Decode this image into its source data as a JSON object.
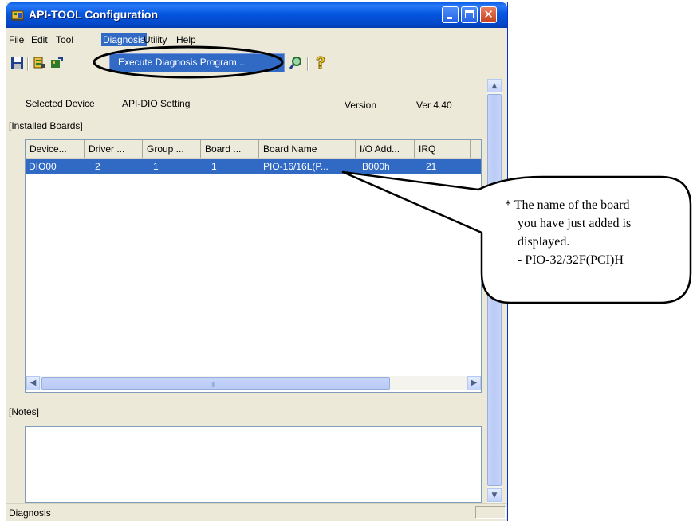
{
  "window": {
    "title": "API-TOOL Configuration"
  },
  "menubar": {
    "items": [
      "File",
      "Edit",
      "Tool",
      "Diagnosis",
      "Utility",
      "Help"
    ],
    "active": "Diagnosis"
  },
  "dropdown": {
    "item": "Execute Diagnosis Program..."
  },
  "toolbar": {
    "icons": [
      "save-icon",
      "settings-icon",
      "import-icon",
      "magnifier-icon",
      "help-question-icon"
    ]
  },
  "device_info": {
    "selected_device_label": "Selected Device",
    "selected_device_value": "API-DIO Setting",
    "version_label": "Version",
    "version_value": "Ver 4.40"
  },
  "installed_boards": {
    "label": "[Installed Boards]",
    "columns": [
      "Device...",
      "Driver ...",
      "Group ...",
      "Board ...",
      "Board Name",
      "I/O Add...",
      "IRQ"
    ],
    "rows": [
      [
        "DIO00",
        "2",
        "1",
        "1",
        "PIO-16/16L(P...",
        "B000h",
        "21"
      ]
    ],
    "scroll_grip": "III"
  },
  "notes": {
    "label": "[Notes]"
  },
  "statusbar": {
    "text": "Diagnosis"
  },
  "callout": {
    "lines": [
      "* The name of the board",
      "you have just added is",
      "displayed.",
      "- PIO-32/32F(PCI)H"
    ]
  },
  "colors": {
    "selection": "#316ac5",
    "title_bar": "#0456e0",
    "window_bg": "#ece9d8"
  }
}
